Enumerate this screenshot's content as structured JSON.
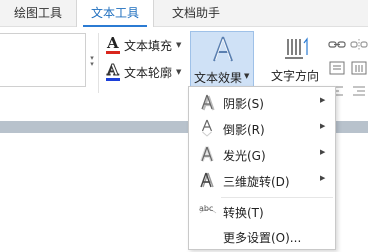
{
  "tabs": [
    {
      "label": "绘图工具",
      "active": false
    },
    {
      "label": "文本工具",
      "active": true
    },
    {
      "label": "文档助手",
      "active": false
    }
  ],
  "ribbon": {
    "text_fill": {
      "label": "文本填充",
      "icon": "text-fill-icon",
      "letter": "A",
      "color": "#d9261c"
    },
    "text_outline": {
      "label": "文本轮廓",
      "icon": "text-outline-icon",
      "letter": "A",
      "color": "#1c3fd9"
    },
    "text_effect": {
      "label": "文本效果",
      "icon": "text-effect-icon"
    },
    "text_direction": {
      "label": "文字方向",
      "icon": "text-direction-icon"
    }
  },
  "menu": {
    "items": [
      {
        "label": "阴影(S)",
        "icon": "shadow-icon",
        "submenu": true
      },
      {
        "label": "倒影(R)",
        "icon": "reflection-icon",
        "submenu": true
      },
      {
        "label": "发光(G)",
        "icon": "glow-icon",
        "submenu": true
      },
      {
        "label": "三维旋转(D)",
        "icon": "3d-rotation-icon",
        "submenu": true
      },
      {
        "label": "转换(T)",
        "icon": "transform-icon",
        "icon_text": "abc",
        "submenu": false
      },
      {
        "label": "更多设置(O)...",
        "icon": "",
        "submenu": false
      }
    ]
  },
  "colors": {
    "accent": "#2b7bd3",
    "active_button_bg": "#cfe1f6"
  }
}
